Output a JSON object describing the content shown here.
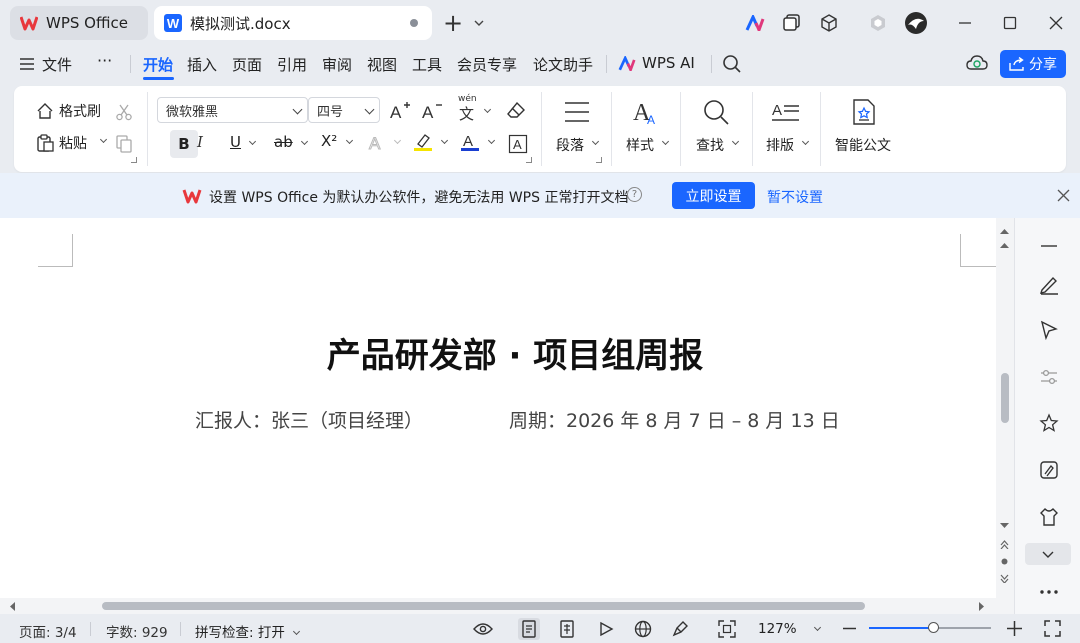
{
  "titlebar": {
    "home_tab": "WPS Office",
    "doc_tab": "模拟测试.docx",
    "add_tab": "+"
  },
  "menubar": {
    "file": "文件",
    "more": "···",
    "items": [
      "开始",
      "插入",
      "页面",
      "引用",
      "审阅",
      "视图",
      "工具",
      "会员专享",
      "论文助手"
    ],
    "ai": "WPS AI",
    "share": "分享"
  },
  "ribbon": {
    "format_painter": "格式刷",
    "paste": "粘贴",
    "font_name": "微软雅黑",
    "font_size": "四号",
    "bold": "B",
    "italic": "I",
    "underline": "U",
    "strike": "ab",
    "superscript": "X²",
    "paragraph": "段落",
    "styles": "样式",
    "find": "查找",
    "layout": "排版",
    "smart_doc": "智能公文",
    "wen": "wén",
    "wen_char": "文"
  },
  "notice": {
    "text": "设置 WPS Office 为默认办公软件，避免无法用 WPS 正常打开文档",
    "help": "?",
    "primary": "立即设置",
    "secondary": "暂不设置"
  },
  "document": {
    "title": "产品研发部 · 项目组周报",
    "reporter": "汇报人：张三（项目经理）",
    "period": "周期：2026 年 8 月 7 日 – 8 月 13 日"
  },
  "statusbar": {
    "page": "页面: 3/4",
    "words": "字数: 929",
    "spell": "拼写检查: 打开",
    "zoom": "127%"
  },
  "colors": {
    "accent": "#1a66ff",
    "wps_red": "#e8383d",
    "highlight": "#f5e400",
    "font_color": "#1a3fd1"
  }
}
